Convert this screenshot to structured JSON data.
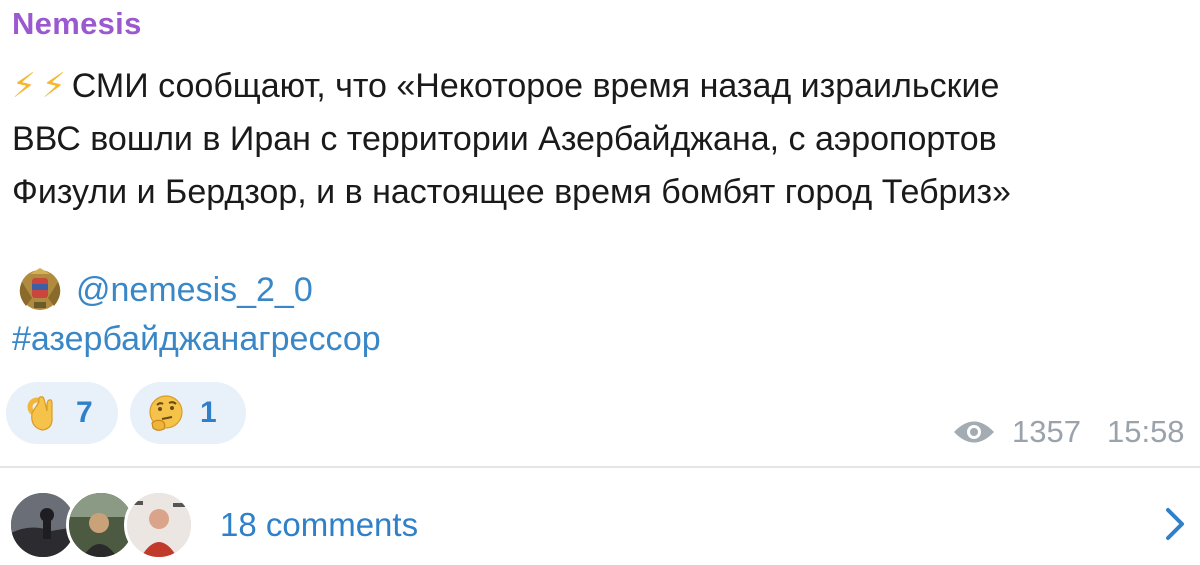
{
  "channel": {
    "name": "Nemesis"
  },
  "post": {
    "line1": "СМИ сообщают, что «Некоторое время назад израильские",
    "line2": "ВВС вошли в Иран с территории Азербайджана, с аэропортов",
    "line3": "Физули и Бердзор, и в настоящее время бомбят город Тебриз»",
    "link": "@nemesis_2_0",
    "hashtag": "#азербайджанагрессор"
  },
  "reactions": [
    {
      "icon": "ok-hand-icon",
      "count": "7"
    },
    {
      "icon": "thinking-face-icon",
      "count": "1"
    }
  ],
  "meta": {
    "views": "1357",
    "time": "15:58"
  },
  "comments": {
    "label": "18 comments"
  },
  "colors": {
    "accent": "#2f80c9",
    "channel": "#9b59d0",
    "reaction_bg": "#e8f1fa",
    "muted": "#9aa3ab"
  }
}
